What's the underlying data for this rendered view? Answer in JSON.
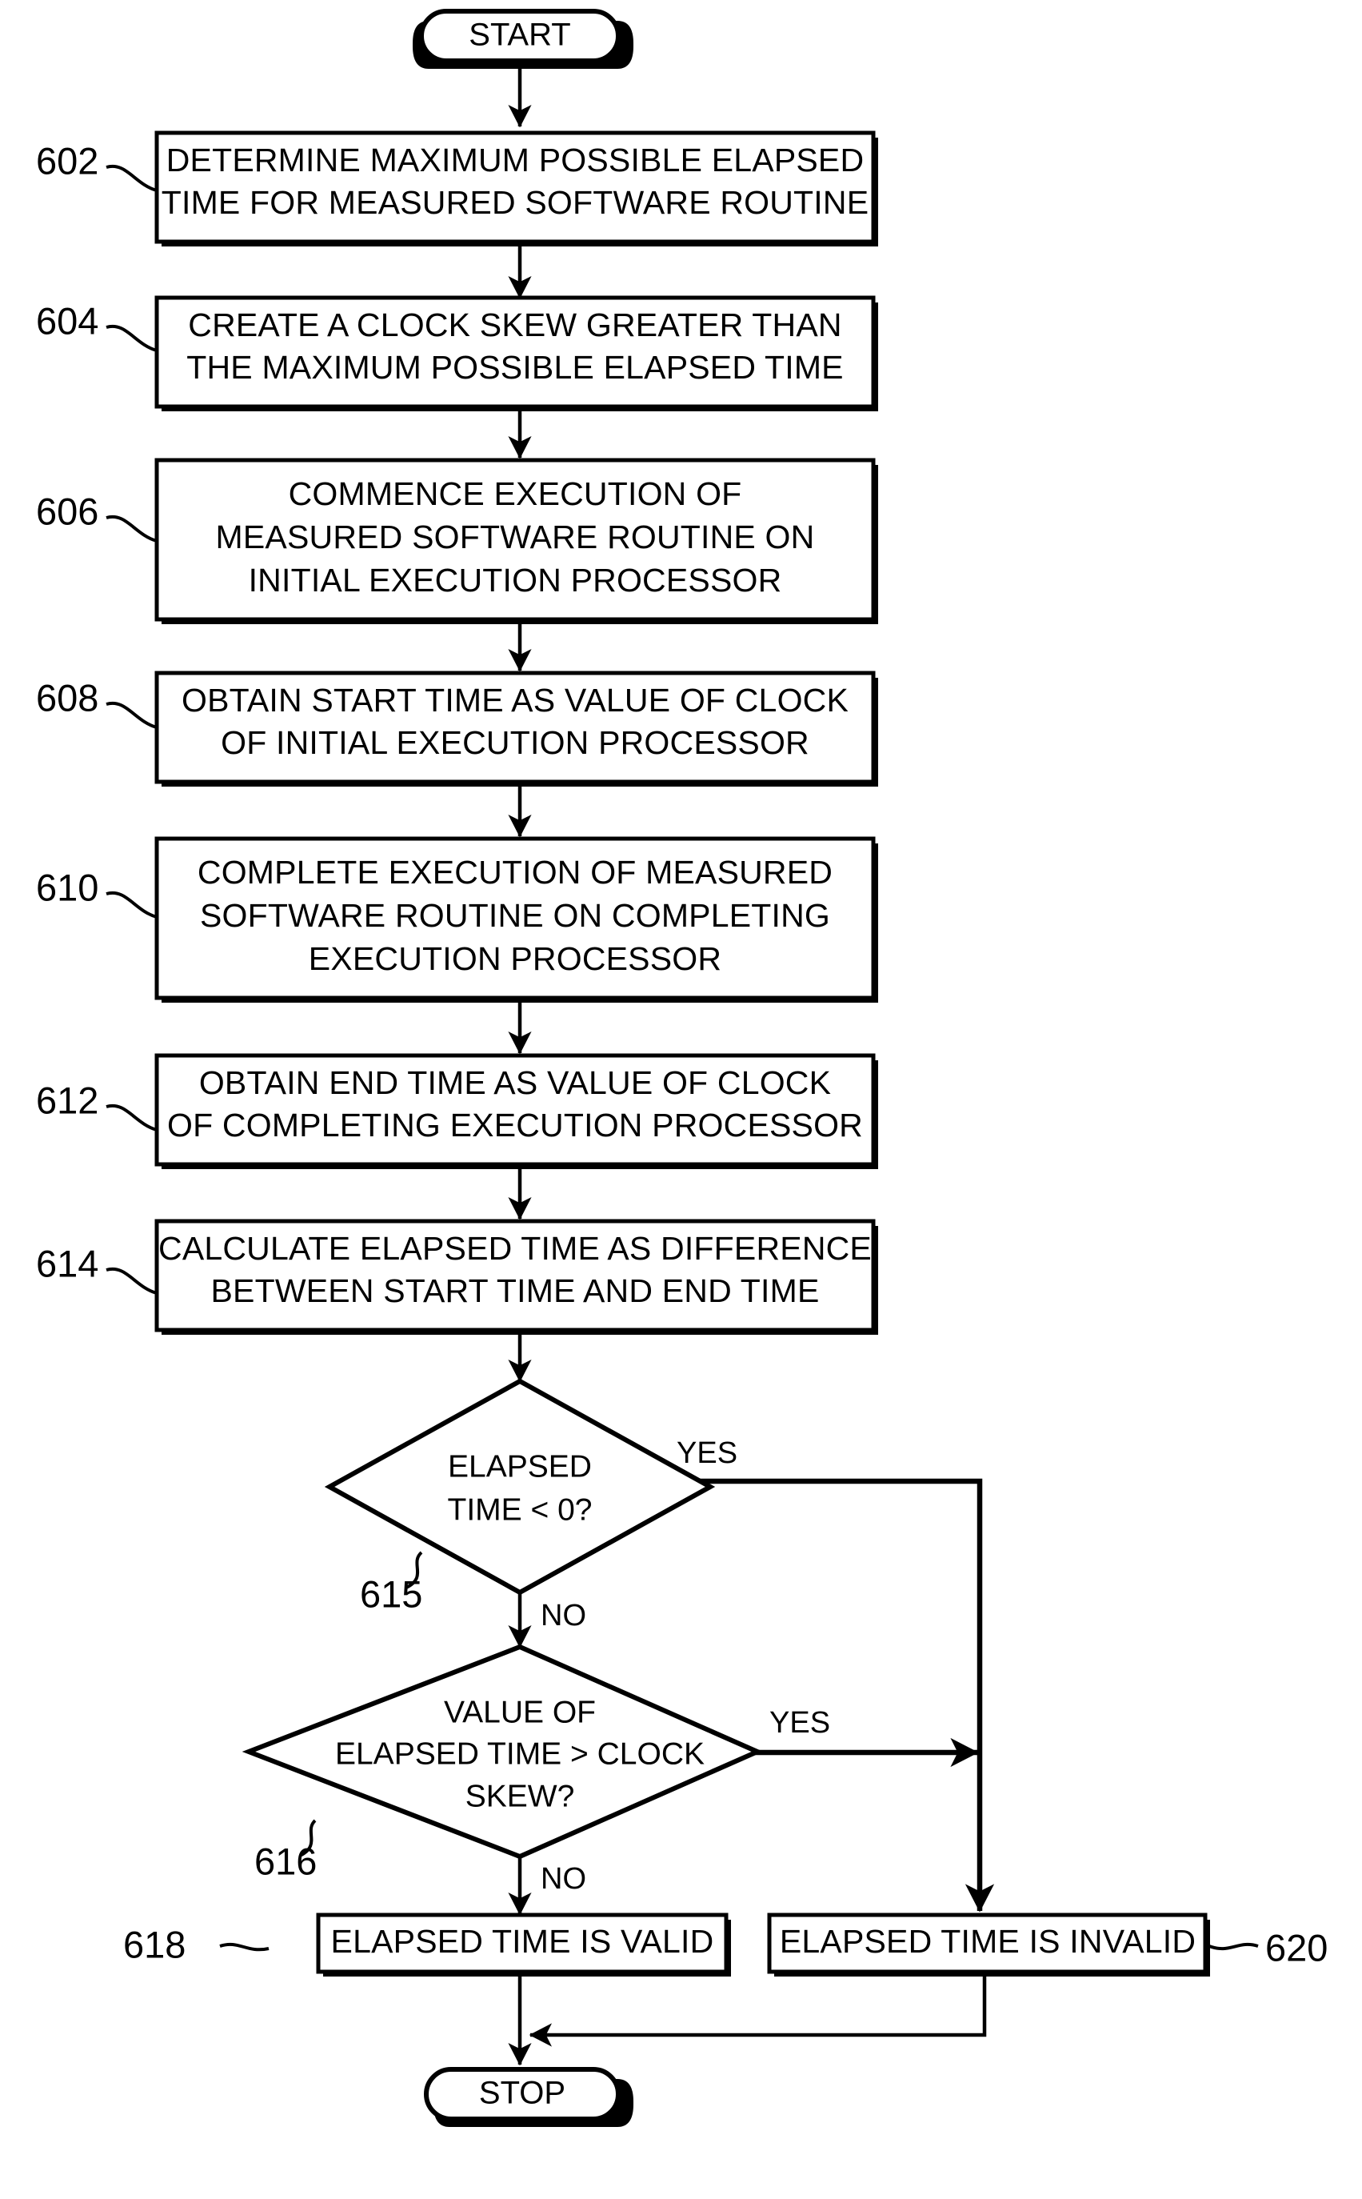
{
  "figure": {
    "type": "flowchart",
    "orientation": "top-to-bottom"
  },
  "nodes": {
    "start": {
      "label": "START",
      "shape": "terminator"
    },
    "stop": {
      "label": "STOP",
      "shape": "terminator"
    },
    "n602": {
      "ref": "602",
      "shape": "process",
      "lines": [
        "DETERMINE MAXIMUM POSSIBLE ELAPSED",
        "TIME FOR MEASURED SOFTWARE ROUTINE"
      ]
    },
    "n604": {
      "ref": "604",
      "shape": "process",
      "lines": [
        "CREATE A CLOCK SKEW GREATER THAN",
        "THE MAXIMUM POSSIBLE ELAPSED TIME"
      ]
    },
    "n606": {
      "ref": "606",
      "shape": "process",
      "lines": [
        "COMMENCE EXECUTION OF",
        "MEASURED SOFTWARE ROUTINE ON",
        "INITIAL EXECUTION PROCESSOR"
      ]
    },
    "n608": {
      "ref": "608",
      "shape": "process",
      "lines": [
        "OBTAIN START TIME AS VALUE OF CLOCK",
        "OF INITIAL EXECUTION PROCESSOR"
      ]
    },
    "n610": {
      "ref": "610",
      "shape": "process",
      "lines": [
        "COMPLETE EXECUTION OF MEASURED",
        "SOFTWARE ROUTINE ON COMPLETING",
        "EXECUTION PROCESSOR"
      ]
    },
    "n612": {
      "ref": "612",
      "shape": "process",
      "lines": [
        "OBTAIN END TIME AS VALUE OF CLOCK",
        "OF COMPLETING EXECUTION PROCESSOR"
      ]
    },
    "n614": {
      "ref": "614",
      "shape": "process",
      "lines": [
        "CALCULATE ELAPSED TIME AS DIFFERENCE",
        "BETWEEN START TIME AND END TIME"
      ]
    },
    "n615": {
      "ref": "615",
      "shape": "decision",
      "lines": [
        "ELAPSED",
        "TIME < 0?"
      ]
    },
    "n616": {
      "ref": "616",
      "shape": "decision",
      "lines": [
        "VALUE OF",
        "ELAPSED TIME > CLOCK",
        "SKEW?"
      ]
    },
    "n618": {
      "ref": "618",
      "shape": "process",
      "lines": [
        "ELAPSED TIME IS VALID"
      ]
    },
    "n620": {
      "ref": "620",
      "shape": "process",
      "lines": [
        "ELAPSED TIME IS INVALID"
      ]
    }
  },
  "edge_labels": {
    "yes_615": "YES",
    "no_615": "NO",
    "yes_616": "YES",
    "no_616": "NO"
  },
  "colors": {
    "stroke": "#000000",
    "fill": "#ffffff",
    "background": "#ffffff"
  }
}
